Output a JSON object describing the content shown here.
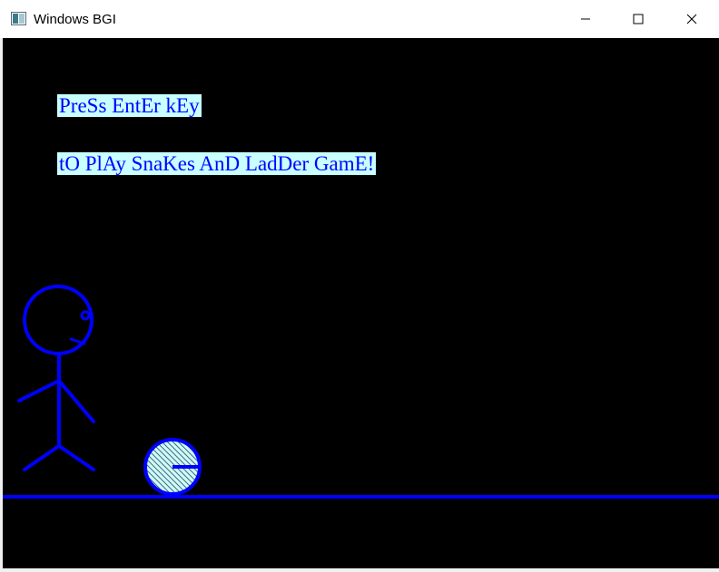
{
  "window": {
    "title": "Windows BGI"
  },
  "screen": {
    "line1": "PreSs EntEr kEy",
    "line2": "tO PlAy SnaKes AnD LadDer GamE!"
  },
  "colors": {
    "background": "#000000",
    "drawing": "#0000ff",
    "text_highlight": "#c8ffff",
    "ball_fill": "#c8ffff"
  }
}
